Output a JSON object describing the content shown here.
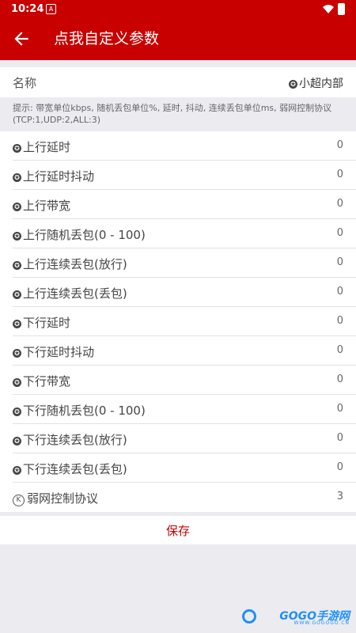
{
  "statusbar": {
    "time": "10:24"
  },
  "appbar": {
    "title": "点我自定义参数"
  },
  "name_row": {
    "label": "名称",
    "value": "小超内部"
  },
  "hint": "提示: 带宽单位kbps, 随机丢包单位%, 延时, 抖动, 连续丢包单位ms, 弱网控制协议(TCP:1,UDP:2,ALL:3)",
  "items": [
    {
      "label": "上行延时",
      "value": "0"
    },
    {
      "label": "上行延时抖动",
      "value": "0"
    },
    {
      "label": "上行带宽",
      "value": "0"
    },
    {
      "label": "上行随机丢包(0 - 100)",
      "value": "0"
    },
    {
      "label": "上行连续丢包(放行)",
      "value": "0"
    },
    {
      "label": "上行连续丢包(丢包)",
      "value": "0"
    },
    {
      "label": "下行延时",
      "value": "0"
    },
    {
      "label": "下行延时抖动",
      "value": "0"
    },
    {
      "label": "下行带宽",
      "value": "0"
    },
    {
      "label": "下行随机丢包(0 - 100)",
      "value": "0"
    },
    {
      "label": "下行连续丢包(放行)",
      "value": "0"
    },
    {
      "label": "下行连续丢包(丢包)",
      "value": "0"
    }
  ],
  "protocol": {
    "label": "弱网控制协议",
    "value": "3"
  },
  "save_label": "保存",
  "watermark": {
    "text": "GOGO手游网",
    "sub": "WWW.GOGOGO.CN"
  },
  "colors": {
    "primary": "#c90000",
    "background": "#ececf0",
    "watermark": "#1f8fff"
  },
  "icons": {
    "back": "arrow-left-icon",
    "item": "star-icon",
    "protocol": "k-circle-icon"
  }
}
